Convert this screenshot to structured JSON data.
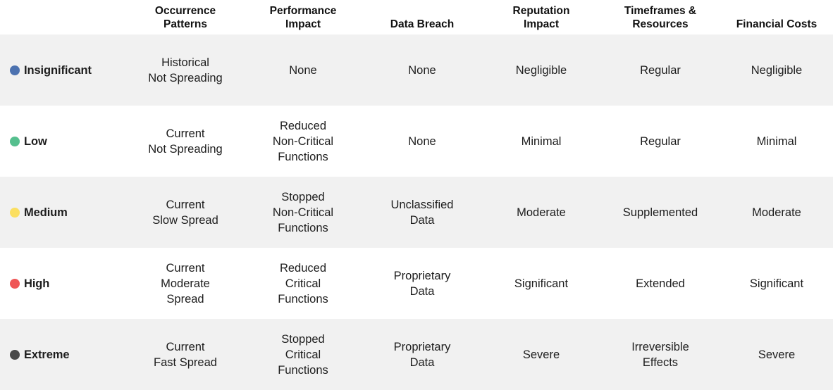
{
  "table": {
    "columns": [
      {
        "id": "level",
        "label": ""
      },
      {
        "id": "occurrence_patterns",
        "label": "Occurrence\nPatterns"
      },
      {
        "id": "performance_impact",
        "label": "Performance\nImpact"
      },
      {
        "id": "data_breach",
        "label": "Data Breach"
      },
      {
        "id": "reputation_impact",
        "label": "Reputation\nImpact"
      },
      {
        "id": "timeframes_resources",
        "label": "Timeframes &\nResources"
      },
      {
        "id": "financial_costs",
        "label": "Financial Costs"
      }
    ],
    "colors": {
      "insignificant": "#4c72b0",
      "low": "#55bf8e",
      "medium": "#fbdf61",
      "high": "#ef5656",
      "extreme": "#4a4a4a",
      "stripe": "#f1f1f1",
      "background": "#ffffff",
      "text": "#1d1d1d"
    },
    "rows": [
      {
        "level": "Insignificant",
        "dot_color": "#4c72b0",
        "occurrence_patterns": [
          "Historical",
          "Not Spreading"
        ],
        "performance_impact": [
          "None"
        ],
        "data_breach": [
          "None"
        ],
        "reputation_impact": [
          "Negligible"
        ],
        "timeframes_resources": [
          "Regular"
        ],
        "financial_costs": [
          "Negligible"
        ]
      },
      {
        "level": "Low",
        "dot_color": "#55bf8e",
        "occurrence_patterns": [
          "Current",
          "Not Spreading"
        ],
        "performance_impact": [
          "Reduced",
          "Non-Critical",
          "Functions"
        ],
        "data_breach": [
          "None"
        ],
        "reputation_impact": [
          "Minimal"
        ],
        "timeframes_resources": [
          "Regular"
        ],
        "financial_costs": [
          "Minimal"
        ]
      },
      {
        "level": "Medium",
        "dot_color": "#fbdf61",
        "occurrence_patterns": [
          "Current",
          "Slow Spread"
        ],
        "performance_impact": [
          "Stopped",
          "Non-Critical",
          "Functions"
        ],
        "data_breach": [
          "Unclassified",
          "Data"
        ],
        "reputation_impact": [
          "Moderate"
        ],
        "timeframes_resources": [
          "Supplemented"
        ],
        "financial_costs": [
          "Moderate"
        ]
      },
      {
        "level": "High",
        "dot_color": "#ef5656",
        "occurrence_patterns": [
          "Current",
          "Moderate",
          "Spread"
        ],
        "performance_impact": [
          "Reduced",
          "Critical",
          "Functions"
        ],
        "data_breach": [
          "Proprietary",
          "Data"
        ],
        "reputation_impact": [
          "Significant"
        ],
        "timeframes_resources": [
          "Extended"
        ],
        "financial_costs": [
          "Significant"
        ]
      },
      {
        "level": "Extreme",
        "dot_color": "#4a4a4a",
        "occurrence_patterns": [
          "Current",
          "Fast Spread"
        ],
        "performance_impact": [
          "Stopped",
          "Critical",
          "Functions"
        ],
        "data_breach": [
          "Proprietary",
          "Data"
        ],
        "reputation_impact": [
          "Severe"
        ],
        "timeframes_resources": [
          "Irreversible",
          "Effects"
        ],
        "financial_costs": [
          "Severe"
        ]
      }
    ]
  }
}
